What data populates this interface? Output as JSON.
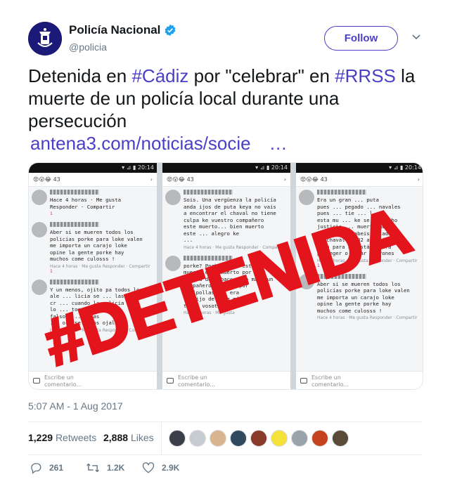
{
  "author": {
    "display_name": "Policía Nacional",
    "handle": "@policia",
    "verified": true
  },
  "follow_label": "Follow",
  "tweet": {
    "part1": "Detenida en ",
    "hashtag1": "#Cádiz",
    "part2": " por \"celebrar\" en ",
    "hashtag2": "#RRSS",
    "part3": " la muerte de un policía local durante una persecución",
    "link": "antena3.com/noticias/socie",
    "link_ellipsis": "…"
  },
  "media": {
    "stamp_text": "#DETENIDA",
    "phones": [
      {
        "status": " ▾ ⊿ ▮ 20:14",
        "count": "😡😮😂 43",
        "comments": [
          {
            "body": "Hace 4 horas · Me gusta\nResponder · Compartir",
            "meta": "",
            "react": "1"
          },
          {
            "body": "Aber si se mueren todos los\npolicías porke para loke valen\nme importa un carajo loke\nopine la gente porke hay\nmuchos come culosss !",
            "meta": "Hace 4 horas · Me gusta\nResponder · Compartir",
            "react": "1"
          },
          {
            "body": "Y un menos, ojito pa todos los\nale ... licia se ... las\ncr ... cuando la policia\nlo ... tos son\nfalsos ... icias\n... orirse todos ojala",
            "meta": "Hace 4 horas · Me gusta\nResponder · Compartir",
            "react": "1"
          }
        ],
        "write": "Escribe un\ncomentario..."
      },
      {
        "status": " ▾ ⊿ ▮ 20:14",
        "count": "😡😮😂 43",
        "comments": [
          {
            "body": "Sois. Una vergüenza la policía\nanda ijos de puta keya no vais\na encontrar el chaval no tiene\nculpa ke vuestro compañero\neste muerto... bien muerto\neste ... alegro ke\n...",
            "meta": "Hace 4 horas · Me gusta\nResponder · Compartir",
            "react": ""
          },
          {
            "body": "porke? Porke el ke esta\nmuerto esta muerto por una\nmierda de tabaco y lo mató un\ncompañero vuestro por\ngilipollas ... era\nun hijo de puta más como\ntodos vosotros",
            "meta": "Hace 4 horas · Me gusta",
            "react": ""
          }
        ],
        "write": "Escribe un\ncomentario..."
      },
      {
        "status": " ▾ ⊿ ▮ 20:14",
        "count": "😡😮😂 43",
        "comments": [
          {
            "body": "Era un gran ... puta\npues ... pegado ... navales\npues ... tie ... l\nesta mu ... ke se aya echo\njusticia ... muerte muy\nbien ... ke abeis matado a\nun chaval de 32 años ijos de\nputa para ke estáis para\nproteger o matar cabrones",
            "meta": "Hace 4 horas · Me gusta\nResponder · Compartir",
            "react": "1"
          },
          {
            "body": "Aber si se mueren todos los\npolicías porke para loke valen\nme importa un carajo loke\nopine la gente porke hay\nmuchos come culosss !",
            "meta": "Hace 4 horas · Me gusta\nResponder · Compartir",
            "react": ""
          }
        ],
        "write": "Escribe un\ncomentario..."
      }
    ]
  },
  "timestamp": "5:07 AM - 1 Aug 2017",
  "stats": {
    "retweets_count": "1,229",
    "retweets_label": "Retweets",
    "likes_count": "2,888",
    "likes_label": "Likes"
  },
  "liker_colors": [
    "#3a3f4a",
    "#c7ccd2",
    "#d9b58f",
    "#2f4a5f",
    "#8a3a2a",
    "#f2e23a",
    "#9aa3ab",
    "#c7421e",
    "#5a4a3a"
  ],
  "actions": {
    "replies": "261",
    "retweets": "1.2K",
    "likes": "2.9K"
  },
  "colors": {
    "accent": "#4a3fc6",
    "verified": "#1da1f2",
    "stamp": "#e3141b"
  }
}
